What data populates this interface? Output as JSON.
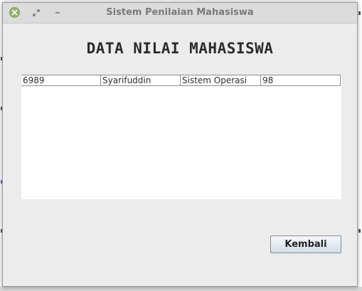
{
  "window": {
    "title": "Sistem Penilaian Mahasiswa",
    "controls": {
      "close_icon": "close-icon",
      "restore_icon": "restore-icon",
      "minimize_icon": "minimize-icon"
    },
    "accent_color": "#8fb56a"
  },
  "heading": "DATA NILAI MAHASISWA",
  "table": {
    "rows": [
      [
        "6989",
        "Syarifuddin",
        "Sistem Operasi",
        "98"
      ]
    ]
  },
  "actions": {
    "back_label": "Kembali"
  }
}
